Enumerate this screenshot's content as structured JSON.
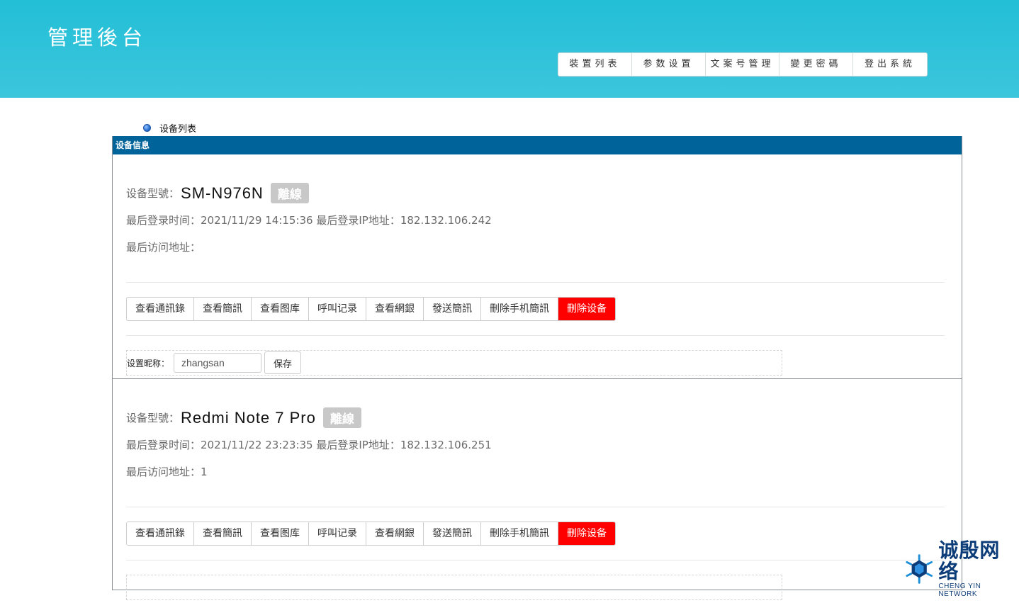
{
  "header": {
    "title": "管理後台",
    "nav": [
      "裝置列表",
      "参数设置",
      "文案号管理",
      "變更密碼",
      "登出系統"
    ]
  },
  "breadcrumb": {
    "label": "设备列表"
  },
  "panel": {
    "title": "设备信息"
  },
  "devices": [
    {
      "model_label": "设备型號：",
      "model": "SM-N976N",
      "status": "離線",
      "last_login": "最后登录时间：2021/11/29 14:15:36 最后登录IP地址：182.132.106.242",
      "last_visit": "最后访问地址：",
      "actions": [
        "查看通訊錄",
        "查看簡訊",
        "查看图库",
        "呼叫记录",
        "查看網銀",
        "發送簡訊",
        "刪除手机簡訊",
        "刪除设备"
      ],
      "nickname_label": "设置昵称：",
      "nickname_value": "zhangsan",
      "save_label": "保存"
    },
    {
      "model_label": "设备型號：",
      "model": "Redmi Note 7 Pro",
      "status": "離線",
      "last_login": "最后登录时间：2021/11/22 23:23:35 最后登录IP地址：182.132.106.251",
      "last_visit": "最后访问地址：1",
      "actions": [
        "查看通訊錄",
        "查看簡訊",
        "查看图库",
        "呼叫记录",
        "查看網銀",
        "發送簡訊",
        "刪除手机簡訊",
        "刪除设备"
      ]
    }
  ],
  "watermark": {
    "cn": "诚殷网络",
    "en": "CHENG YIN NETWORK"
  },
  "colors": {
    "header_bg": "#2ec3da",
    "panel_title_bg": "#00639a",
    "danger": "#ff0000",
    "badge": "#c8c8c8"
  }
}
